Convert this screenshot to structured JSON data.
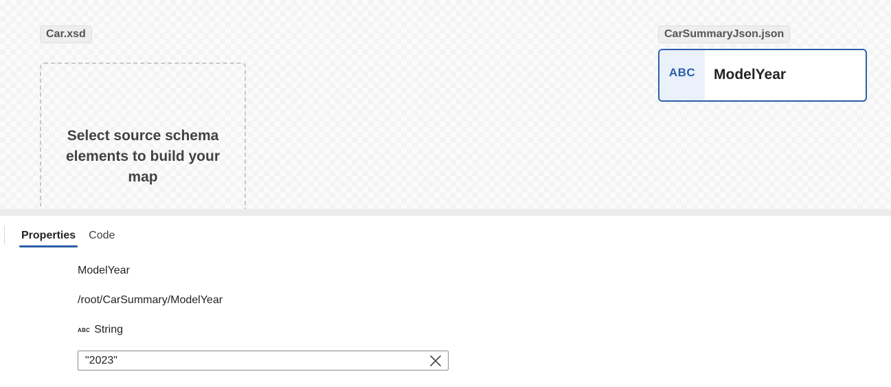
{
  "canvas": {
    "source_schema": "Car.xsd",
    "target_schema": "CarSummaryJson.json",
    "placeholder": "Select source schema elements to build your map",
    "target_node": {
      "type_badge": "ABC",
      "label": "ModelYear",
      "icon": "abc-string-icon"
    }
  },
  "panel": {
    "tabs": [
      {
        "label": "Properties",
        "active": true
      },
      {
        "label": "Code",
        "active": false
      }
    ],
    "properties": {
      "name": "ModelYear",
      "path": "/root/CarSummary/ModelYear",
      "type_icon": "ABC",
      "type": "String",
      "value": "\"2023\"",
      "clear_icon": "close-icon"
    }
  },
  "colors": {
    "accent": "#2b5fa8",
    "node_type_bg": "#eaf1fb",
    "splitter": "#ececec"
  }
}
